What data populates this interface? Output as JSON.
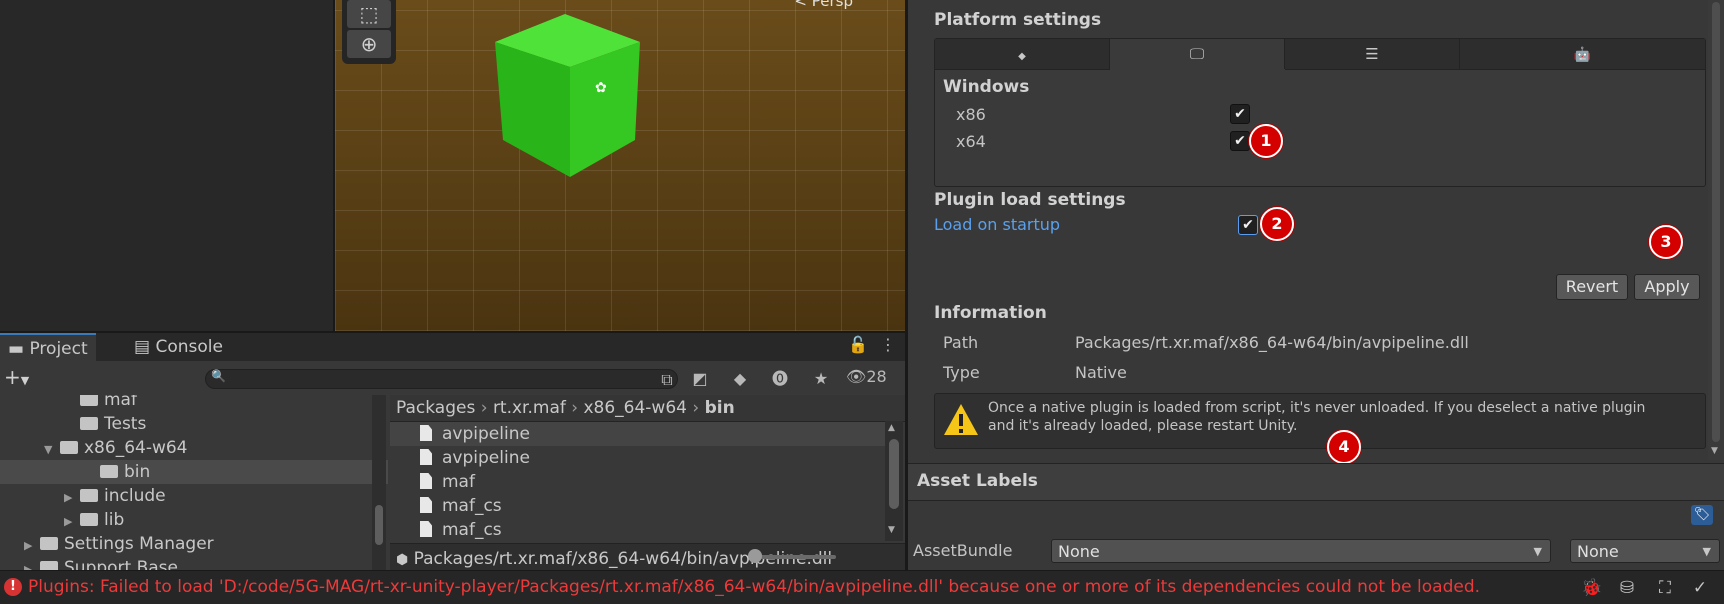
{
  "scene": {
    "persp_label": "< Persp"
  },
  "inspector": {
    "platform_settings_title": "Platform settings",
    "platform_tabs": [
      {
        "icon": "unity-icon",
        "glyph": "◆"
      },
      {
        "icon": "monitor-icon",
        "glyph": "🖵"
      },
      {
        "icon": "server-icon",
        "glyph": "☰"
      },
      {
        "icon": "android-icon",
        "glyph": "🤖"
      }
    ],
    "windows_title": "Windows",
    "arch_x86": "x86",
    "arch_x64": "x64",
    "plugin_load_title": "Plugin load settings",
    "load_on_startup": "Load on startup",
    "revert_label": "Revert",
    "apply_label": "Apply",
    "information_title": "Information",
    "path_label": "Path",
    "path_value": "Packages/rt.xr.maf/x86_64-w64/bin/avpipeline.dll",
    "type_label": "Type",
    "type_value": "Native",
    "warning_line1": "Once a native plugin is loaded from script, it's never unloaded. If you deselect a native plugin",
    "warning_line2": "and it's already loaded, please restart Unity.",
    "asset_labels_title": "Asset Labels",
    "assetbundle_label": "AssetBundle",
    "assetbundle_value": "None",
    "assetbundle_variant": "None"
  },
  "markers": [
    "1",
    "2",
    "3",
    "4"
  ],
  "project": {
    "tab_project": "Project",
    "tab_console": "Console",
    "hidden_count": "28",
    "search_placeholder": "",
    "tree": [
      {
        "label": "maf",
        "indent": 3,
        "arrow": ""
      },
      {
        "label": "Tests",
        "indent": 3,
        "arrow": ""
      },
      {
        "label": "x86_64-w64",
        "indent": 2,
        "arrow": "▼"
      },
      {
        "label": "bin",
        "indent": 4,
        "arrow": ""
      },
      {
        "label": "include",
        "indent": 3,
        "arrow": "▶"
      },
      {
        "label": "lib",
        "indent": 3,
        "arrow": "▶"
      },
      {
        "label": "Settings Manager",
        "indent": 1,
        "arrow": "▶"
      },
      {
        "label": "Support Base",
        "indent": 1,
        "arrow": "▶"
      }
    ],
    "breadcrumb": [
      "Packages",
      "rt.xr.maf",
      "x86_64-w64",
      "bin"
    ],
    "files": [
      "avpipeline",
      "avpipeline",
      "maf",
      "maf_cs",
      "maf_cs"
    ],
    "footer_path": "Packages/rt.xr.maf/x86_64-w64/bin/avpipeline.dll"
  },
  "status": {
    "error_text": "Plugins: Failed to load 'D:/code/5G-MAG/rt-xr-unity-player/Packages/rt.xr.maf/x86_64-w64/bin/avpipeline.dll' because one or more of its dependencies could not be loaded."
  },
  "colors": {
    "accent_blue": "#3a79bb",
    "error_red": "#ec3a3a",
    "marker_red": "#d40000",
    "cube_green": "#2fbf1b"
  }
}
